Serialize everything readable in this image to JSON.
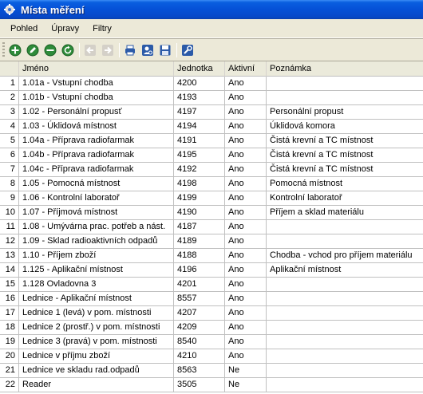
{
  "window": {
    "title": "Místa měření"
  },
  "menu": {
    "items": [
      "Pohled",
      "Úpravy",
      "Filtry"
    ]
  },
  "toolbar": {
    "buttons": [
      {
        "name": "add-icon",
        "color": "#2e8b3a"
      },
      {
        "name": "edit-icon",
        "color": "#2e8b3a"
      },
      {
        "name": "remove-icon",
        "color": "#2e8b3a"
      },
      {
        "name": "refresh-icon",
        "color": "#2e8b3a"
      },
      {
        "name": "back-arrow-icon",
        "color": "#a0a0a0"
      },
      {
        "name": "forward-arrow-icon",
        "color": "#a0a0a0"
      },
      {
        "name": "print-icon",
        "color": "#2b5aa8"
      },
      {
        "name": "user-search-icon",
        "color": "#2b5aa8"
      },
      {
        "name": "save-icon",
        "color": "#2b5aa8"
      },
      {
        "name": "tools-icon",
        "color": "#2b5aa8"
      }
    ]
  },
  "table": {
    "columns": [
      "Jméno",
      "Jednotka",
      "Aktivní",
      "Poznámka"
    ],
    "rows": [
      {
        "n": "1",
        "name": "1.01a - Vstupní chodba",
        "unit": "4200",
        "active": "Ano",
        "note": ""
      },
      {
        "n": "2",
        "name": "1.01b - Vstupní chodba",
        "unit": "4193",
        "active": "Ano",
        "note": ""
      },
      {
        "n": "3",
        "name": "1.02 - Personální propusť",
        "unit": "4197",
        "active": "Ano",
        "note": "Personální propust"
      },
      {
        "n": "4",
        "name": "1.03 - Úklidová místnost",
        "unit": "4194",
        "active": "Ano",
        "note": "Úklidová komora"
      },
      {
        "n": "5",
        "name": "1.04a - Příprava radiofarmak",
        "unit": "4191",
        "active": "Ano",
        "note": "Čistá krevní a TC místnost"
      },
      {
        "n": "6",
        "name": "1.04b - Příprava radiofarmak",
        "unit": "4195",
        "active": "Ano",
        "note": "Čistá krevní a TC místnost"
      },
      {
        "n": "7",
        "name": "1.04c - Příprava radiofarmak",
        "unit": "4192",
        "active": "Ano",
        "note": "Čistá krevní a TC místnost"
      },
      {
        "n": "8",
        "name": "1.05 - Pomocná místnost",
        "unit": "4198",
        "active": "Ano",
        "note": "Pomocná místnost"
      },
      {
        "n": "9",
        "name": "1.06 - Kontrolní laboratoř",
        "unit": "4199",
        "active": "Ano",
        "note": "Kontrolní laboratoř"
      },
      {
        "n": "10",
        "name": "1.07 - Příjmová místnost",
        "unit": "4190",
        "active": "Ano",
        "note": "Příjem a sklad materiálu"
      },
      {
        "n": "11",
        "name": "1.08 - Umývárna prac. potřeb a nást.",
        "unit": "4187",
        "active": "Ano",
        "note": ""
      },
      {
        "n": "12",
        "name": "1.09 - Sklad radioaktivních odpadů",
        "unit": "4189",
        "active": "Ano",
        "note": ""
      },
      {
        "n": "13",
        "name": "1.10 - Příjem zboží",
        "unit": "4188",
        "active": "Ano",
        "note": "Chodba - vchod pro příjem materiálu"
      },
      {
        "n": "14",
        "name": "1.125 - Aplikační místnost",
        "unit": "4196",
        "active": "Ano",
        "note": "Aplikační místnost"
      },
      {
        "n": "15",
        "name": "1.128 Ovladovna 3",
        "unit": "4201",
        "active": "Ano",
        "note": ""
      },
      {
        "n": "16",
        "name": "Lednice - Aplikační místnost",
        "unit": "8557",
        "active": "Ano",
        "note": ""
      },
      {
        "n": "17",
        "name": "Lednice 1 (levá) v pom. místnosti",
        "unit": "4207",
        "active": "Ano",
        "note": ""
      },
      {
        "n": "18",
        "name": "Lednice 2 (prostř.) v pom. místnosti",
        "unit": "4209",
        "active": "Ano",
        "note": ""
      },
      {
        "n": "19",
        "name": "Lednice 3 (pravá) v pom. místnosti",
        "unit": "8540",
        "active": "Ano",
        "note": ""
      },
      {
        "n": "20",
        "name": "Lednice v příjmu zboží",
        "unit": "4210",
        "active": "Ano",
        "note": ""
      },
      {
        "n": "21",
        "name": "Lednice ve skladu rad.odpadů",
        "unit": "8563",
        "active": "Ne",
        "note": ""
      },
      {
        "n": "22",
        "name": "Reader",
        "unit": "3505",
        "active": "Ne",
        "note": ""
      }
    ]
  }
}
